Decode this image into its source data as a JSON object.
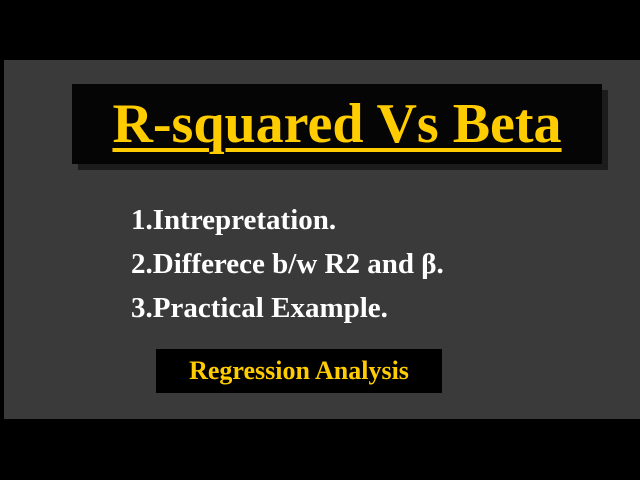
{
  "title": "R-squared Vs Beta",
  "points": [
    "1.Intrepretation.",
    "2.Differece b/w R2 and β.",
    "3.Practical Example."
  ],
  "subtitle": "Regression Analysis",
  "colors": {
    "accent": "#ffcc00",
    "background": "#3a3a3a",
    "text": "#ffffff",
    "box": "#000000"
  }
}
